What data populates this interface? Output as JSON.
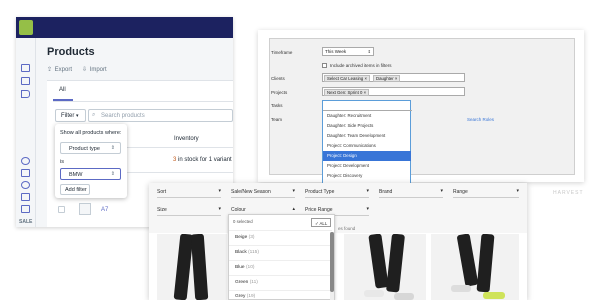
{
  "shopify": {
    "title": "Products",
    "actions": {
      "export": "Export",
      "import": "Import"
    },
    "tabs": [
      "All"
    ],
    "filter_button": "Filter",
    "search_placeholder": "Search products",
    "column_inventory": "Inventory",
    "row_stock": {
      "count": "3",
      "text": "in stock for 1 variant"
    },
    "row_name": "A7",
    "sidebar_label": "SALE",
    "popover": {
      "heading": "Show all products where:",
      "field": "Product type",
      "operator": "is",
      "value": "BMW",
      "add_button": "Add filter"
    },
    "colors": {
      "topbar": "#1c2260",
      "accent": "#5c6ac4",
      "logo": "#95bf47"
    }
  },
  "report_form": {
    "labels": {
      "timeframe": "Timeframe",
      "clients": "Clients",
      "projects": "Projects",
      "tasks": "Tasks",
      "team": "Team"
    },
    "timeframe_value": "This Week",
    "archived_label": "Include archived items in filters",
    "client_tags": [
      "Select Car Leasing",
      "Daughter"
    ],
    "project_tags": [
      "Next Gen: Sprint 0"
    ],
    "search_roles": "Search Roles",
    "task_options": [
      "Daughter: Recruitment",
      "Daughter: Side Projects",
      "Daughter: Team Development",
      "Project: Communications",
      "Project: Design",
      "Project: Development",
      "Project: Discovery"
    ],
    "highlighted_option": "Project: Design",
    "faded_text": "HARVEST"
  },
  "product_filters": {
    "row1": [
      "Sort",
      "Sale/New Season",
      "Product Type",
      "Brand",
      "Range"
    ],
    "row2": [
      "Size",
      "Colour",
      "Price Range"
    ],
    "active_filter": "Colour",
    "colour_panel": {
      "selected_text": "0 selected",
      "all_button": "✓ ALL",
      "options": [
        {
          "name": "Beige",
          "count": "(3)"
        },
        {
          "name": "Black",
          "count": "(115)"
        },
        {
          "name": "Blue",
          "count": "(10)"
        },
        {
          "name": "Green",
          "count": "(11)"
        },
        {
          "name": "Grey",
          "count": "(19)"
        }
      ]
    },
    "found_text": "es found"
  }
}
